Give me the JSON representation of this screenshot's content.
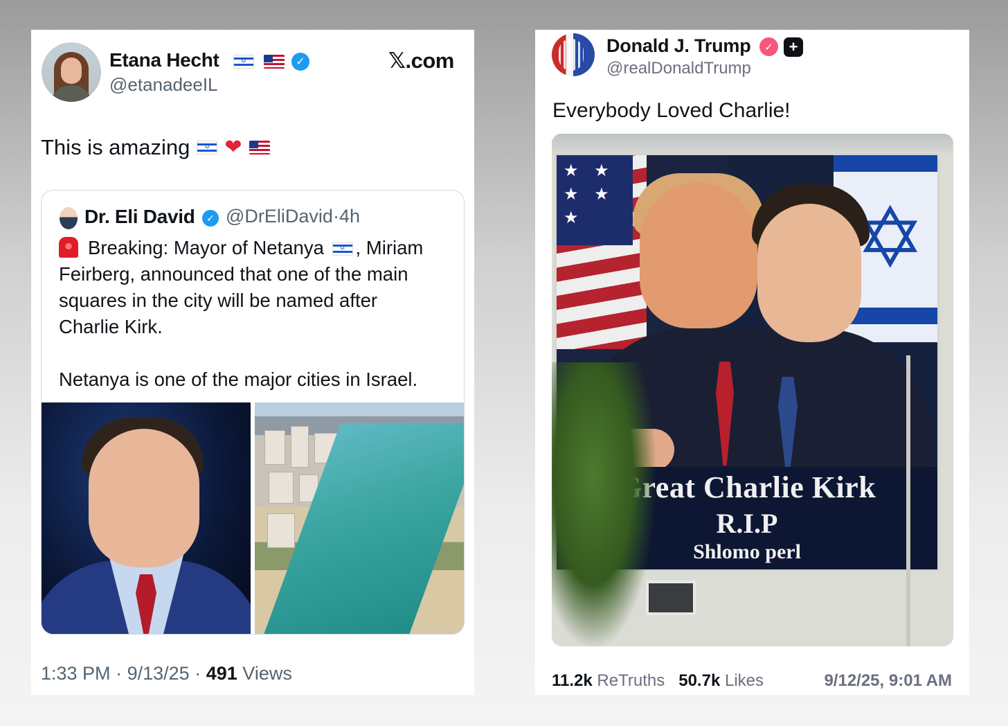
{
  "x_post": {
    "author_name": "Etana Hecht",
    "author_handle": "@etanadeeIL",
    "site_logo": "𝕏.com",
    "text": "This is amazing",
    "quote": {
      "author_name": "Dr. Eli David",
      "author_handle": "@DrEliDavid",
      "separator": "·",
      "age": "4h",
      "line1_before_flag": "Breaking: Mayor of Netanya",
      "line1_after_flag": ", Miriam",
      "line2": "Feirberg, announced that one of the main",
      "line3": "squares in the city will be named after",
      "line4": "Charlie Kirk.",
      "line5": "Netanya is one of the major cities in Israel."
    },
    "time": "1:33 PM",
    "date": "9/13/25",
    "views_count": "491",
    "views_label": "Views",
    "dot": "·"
  },
  "truth_post": {
    "author_name": "Donald J. Trump",
    "author_handle": "@realDonaldTrump",
    "text": "Everybody Loved Charlie!",
    "billboard": {
      "line1": "Great Charlie Kirk",
      "line2": "R.I.P",
      "line3": "Shlomo perl"
    },
    "retruths_count": "11.2k",
    "retruths_label": "ReTruths",
    "likes_count": "50.7k",
    "likes_label": "Likes",
    "timestamp": "9/12/25, 9:01 AM"
  },
  "icons": {
    "verified": "blue-check-icon",
    "truth_verified": "pink-check-icon",
    "plus": "plus-badge-icon",
    "flags": [
      "israel-flag-icon",
      "us-flag-icon"
    ],
    "heart": "red-heart-icon",
    "siren": "siren-icon"
  },
  "colors": {
    "x_blue_check": "#1d9bf0",
    "truth_pink_check": "#f6557d",
    "secondary_text": "#536471"
  }
}
